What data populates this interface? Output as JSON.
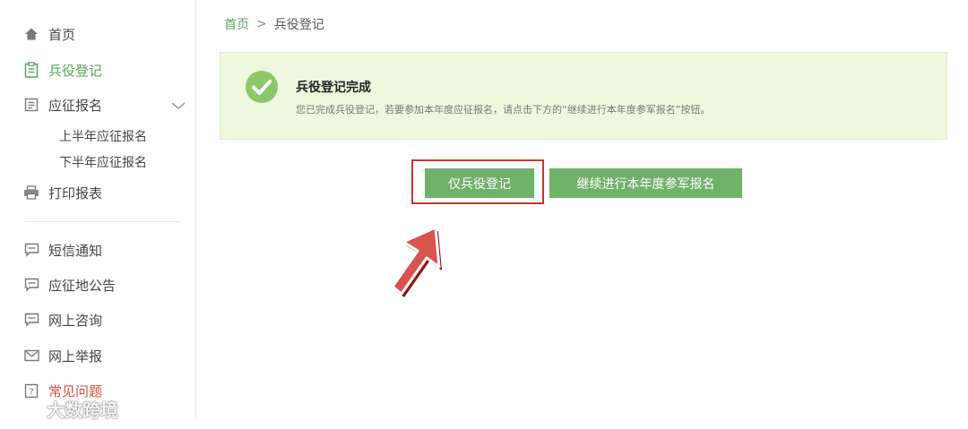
{
  "sidebar": {
    "items": [
      {
        "label": "首页",
        "icon": "home-icon"
      },
      {
        "label": "兵役登记",
        "icon": "clipboard-icon"
      },
      {
        "label": "应征报名",
        "icon": "form-icon"
      },
      {
        "label": "打印报表",
        "icon": "printer-icon"
      },
      {
        "label": "短信通知",
        "icon": "message-icon"
      },
      {
        "label": "应征地公告",
        "icon": "message-icon"
      },
      {
        "label": "网上咨询",
        "icon": "message-icon"
      },
      {
        "label": "网上举报",
        "icon": "mail-icon"
      },
      {
        "label": "常见问题",
        "icon": "question-icon"
      }
    ],
    "sub_items": [
      "上半年应征报名",
      "下半年应征报名"
    ]
  },
  "breadcrumb": {
    "home": "首页",
    "separator": ">",
    "current": "兵役登记"
  },
  "banner": {
    "title": "兵役登记完成",
    "description": "您已完成兵役登记，若要参加本年度应征报名，请点击下方的“继续进行本年度参军报名”按钮。"
  },
  "actions": {
    "primary_label": "仅兵役登记",
    "secondary_label": "继续进行本年度参军报名"
  },
  "watermark": {
    "text": "大数跨境"
  },
  "colors": {
    "accent_green": "#58a55c",
    "button_green": "#71b26b",
    "banner_bg": "#eef8de",
    "highlight_red": "#c0392b",
    "danger_text": "#d94c3c"
  }
}
